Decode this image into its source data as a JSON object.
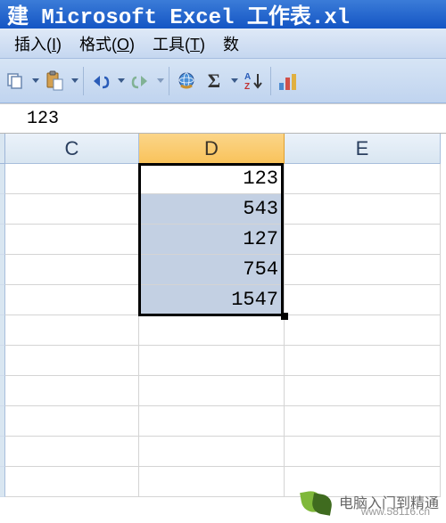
{
  "titlebar": {
    "text": "建 Microsoft Excel 工作表.xl"
  },
  "menubar": {
    "items": [
      {
        "label": "插入",
        "key": "I"
      },
      {
        "label": "格式",
        "key": "O"
      },
      {
        "label": "工具",
        "key": "T"
      },
      {
        "label": "数",
        "key": ""
      }
    ]
  },
  "toolbar": {
    "sigma": "Σ"
  },
  "formula_bar": {
    "value": "123"
  },
  "columns": [
    {
      "key": "C",
      "label": "C",
      "selected": false
    },
    {
      "key": "D",
      "label": "D",
      "selected": true
    },
    {
      "key": "E",
      "label": "E",
      "selected": false
    }
  ],
  "grid": {
    "rows": [
      {
        "c": "",
        "d": "123",
        "e": "",
        "d_active": true
      },
      {
        "c": "",
        "d": "543",
        "e": ""
      },
      {
        "c": "",
        "d": "127",
        "e": ""
      },
      {
        "c": "",
        "d": "754",
        "e": ""
      },
      {
        "c": "",
        "d": "1547",
        "e": ""
      },
      {
        "c": "",
        "d": "",
        "e": ""
      },
      {
        "c": "",
        "d": "",
        "e": ""
      },
      {
        "c": "",
        "d": "",
        "e": ""
      },
      {
        "c": "",
        "d": "",
        "e": ""
      },
      {
        "c": "",
        "d": "",
        "e": ""
      },
      {
        "c": "",
        "d": "",
        "e": ""
      }
    ],
    "selection_col": "d",
    "selection_start_row": 0,
    "selection_end_row": 4
  },
  "watermark": {
    "text": "电脑入门到精通",
    "url": "www.58116.cn"
  }
}
